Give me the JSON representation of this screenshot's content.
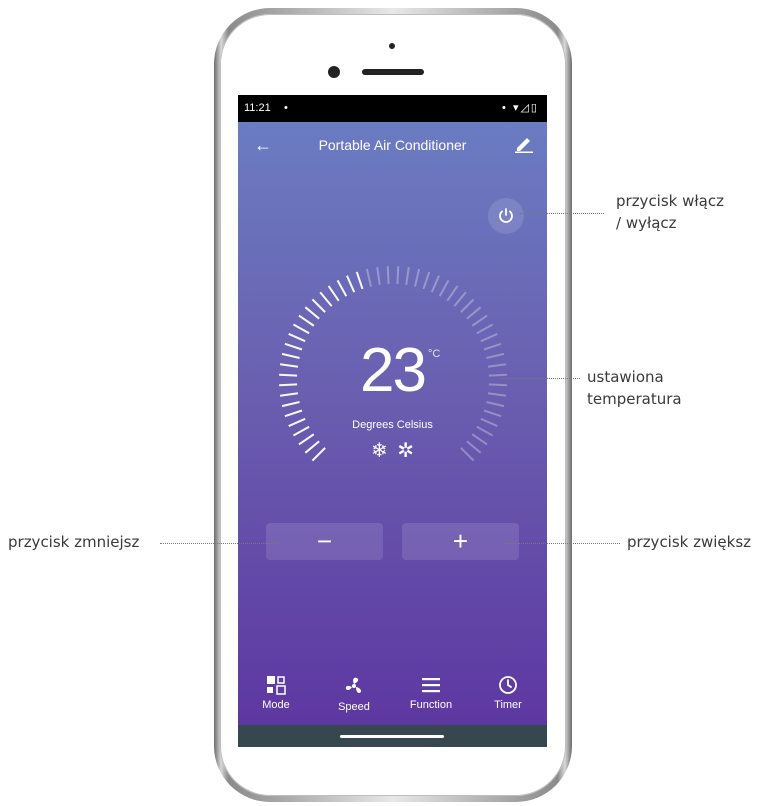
{
  "status_bar": {
    "time": "11:21",
    "notification_dot": "•",
    "right_icons": "• ▾◿▯"
  },
  "app_bar": {
    "title": "Portable Air Conditioner",
    "back_icon": "←"
  },
  "thermostat": {
    "temperature": "23",
    "unit": "°C",
    "caption": "Degrees Celsius",
    "setpoint_fraction": 0.45
  },
  "controls": {
    "minus_label": "−",
    "plus_label": "+"
  },
  "tabs": [
    {
      "label": "Mode",
      "icon": "mode-icon"
    },
    {
      "label": "Speed",
      "icon": "fan-icon"
    },
    {
      "label": "Function",
      "icon": "menu-icon"
    },
    {
      "label": "Timer",
      "icon": "clock-icon"
    }
  ],
  "annotations": {
    "power": "przycisk włącz\n/ wyłącz",
    "temperature": "ustawiona\ntemperatura",
    "decrease": "przycisk zmniejsz",
    "increase": "przycisk zwiększ"
  },
  "colors": {
    "gradient_top": "#6a7fc4",
    "gradient_bottom": "#5c35a0",
    "nav_bar": "#37474f"
  }
}
